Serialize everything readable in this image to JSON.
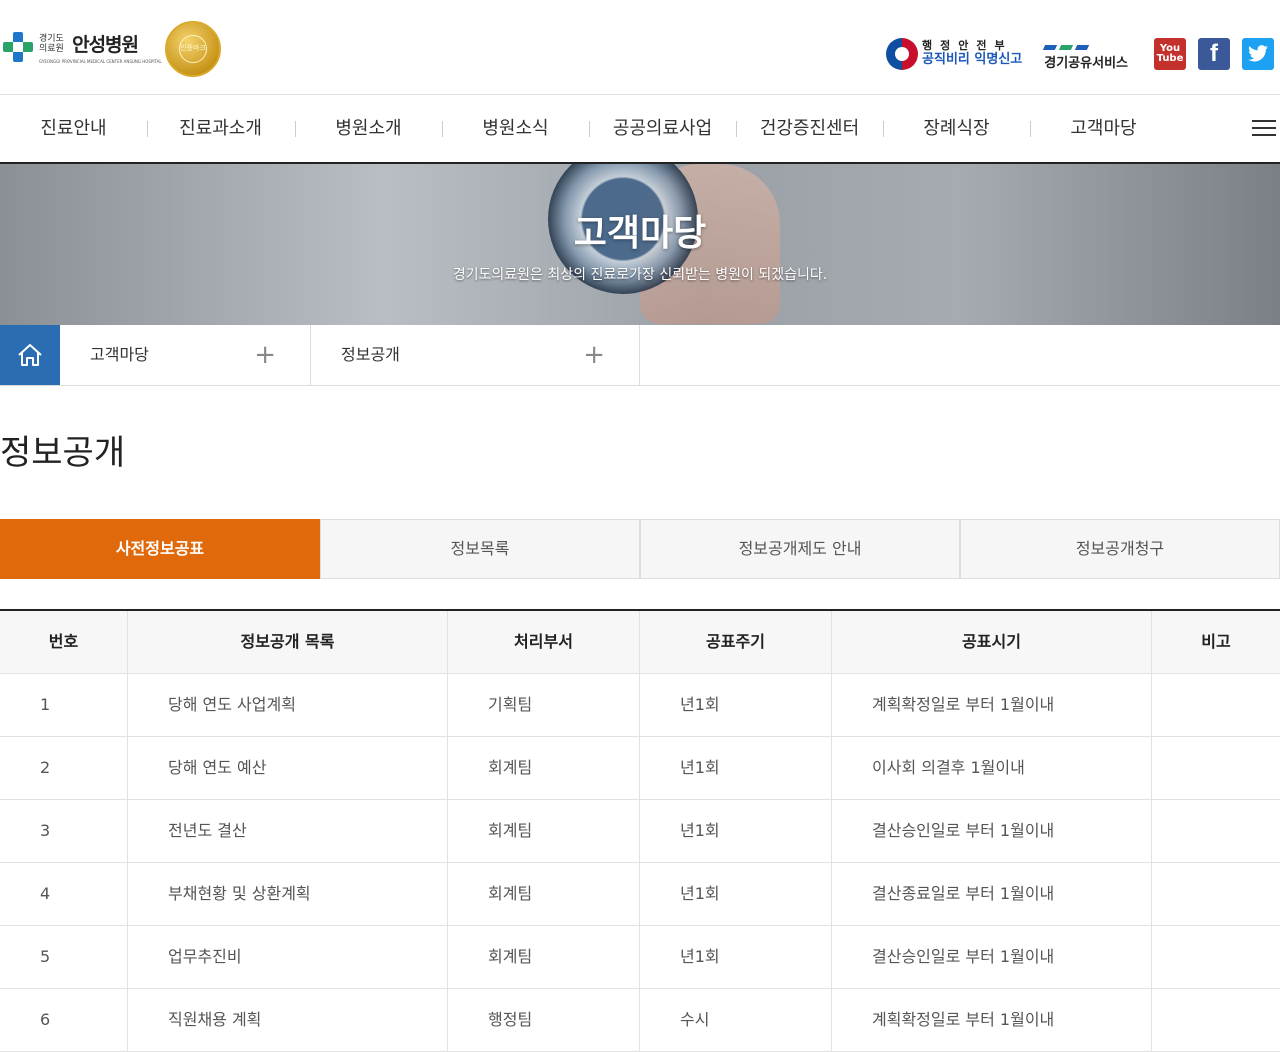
{
  "header": {
    "logo": {
      "small": "경기도 의료원",
      "main": "안성병원",
      "eng": "GYEONGGI PROVINCIAL MEDICAL CENTER ANSUNG HOSPITAL"
    },
    "medal_text": "인증마크",
    "gov": {
      "line1": "행정안전부",
      "line2": "공직비리 익명신고"
    },
    "share": "경기공유서비스",
    "youtube": "You Tube",
    "facebook": "f",
    "twitter": "t"
  },
  "gnb": [
    "진료안내",
    "진료과소개",
    "병원소개",
    "병원소식",
    "공공의료사업",
    "건강증진센터",
    "장례식장",
    "고객마당"
  ],
  "banner": {
    "title": "고객마당",
    "subtitle": "경기도의료원은 최상의 진료로가장 신뢰받는 병원이 되겠습니다."
  },
  "location": {
    "depth1": "고객마당",
    "depth2": "정보공개",
    "plus": "+"
  },
  "page_title": "정보공개",
  "tabs": [
    {
      "label": "사전정보공표",
      "active": true
    },
    {
      "label": "정보목록",
      "active": false
    },
    {
      "label": "정보공개제도 안내",
      "active": false
    },
    {
      "label": "정보공개청구",
      "active": false
    }
  ],
  "table": {
    "headers": [
      "번호",
      "정보공개 목록",
      "처리부서",
      "공표주기",
      "공표시기",
      "비고"
    ],
    "rows": [
      [
        "1",
        "당해 연도 사업계획",
        "기획팀",
        "년1회",
        "계획확정일로 부터 1월이내",
        ""
      ],
      [
        "2",
        "당해 연도 예산",
        "회계팀",
        "년1회",
        "이사회 의결후 1월이내",
        ""
      ],
      [
        "3",
        "전년도 결산",
        "회계팀",
        "년1회",
        "결산승인일로 부터 1월이내",
        ""
      ],
      [
        "4",
        "부채현황 및 상환계획",
        "회계팀",
        "년1회",
        "결산종료일로 부터 1월이내",
        ""
      ],
      [
        "5",
        "업무추진비",
        "회계팀",
        "년1회",
        "결산승인일로 부터 1월이내",
        ""
      ],
      [
        "6",
        "직원채용 계획",
        "행정팀",
        "수시",
        "계획확정일로 부터 1월이내",
        ""
      ]
    ]
  },
  "colors": {
    "accent": "#e06a0b",
    "home": "#2b6db3"
  }
}
